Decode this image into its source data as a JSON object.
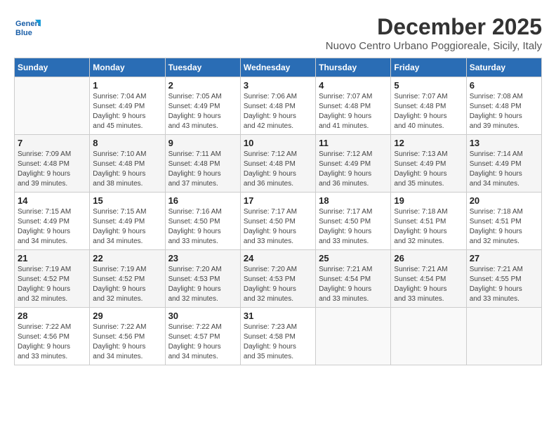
{
  "logo": {
    "line1": "General",
    "line2": "Blue"
  },
  "title": "December 2025",
  "subtitle": "Nuovo Centro Urbano Poggioreale, Sicily, Italy",
  "headers": [
    "Sunday",
    "Monday",
    "Tuesday",
    "Wednesday",
    "Thursday",
    "Friday",
    "Saturday"
  ],
  "weeks": [
    [
      {
        "day": "",
        "info": ""
      },
      {
        "day": "1",
        "info": "Sunrise: 7:04 AM\nSunset: 4:49 PM\nDaylight: 9 hours\nand 45 minutes."
      },
      {
        "day": "2",
        "info": "Sunrise: 7:05 AM\nSunset: 4:49 PM\nDaylight: 9 hours\nand 43 minutes."
      },
      {
        "day": "3",
        "info": "Sunrise: 7:06 AM\nSunset: 4:48 PM\nDaylight: 9 hours\nand 42 minutes."
      },
      {
        "day": "4",
        "info": "Sunrise: 7:07 AM\nSunset: 4:48 PM\nDaylight: 9 hours\nand 41 minutes."
      },
      {
        "day": "5",
        "info": "Sunrise: 7:07 AM\nSunset: 4:48 PM\nDaylight: 9 hours\nand 40 minutes."
      },
      {
        "day": "6",
        "info": "Sunrise: 7:08 AM\nSunset: 4:48 PM\nDaylight: 9 hours\nand 39 minutes."
      }
    ],
    [
      {
        "day": "7",
        "info": "Sunrise: 7:09 AM\nSunset: 4:48 PM\nDaylight: 9 hours\nand 39 minutes."
      },
      {
        "day": "8",
        "info": "Sunrise: 7:10 AM\nSunset: 4:48 PM\nDaylight: 9 hours\nand 38 minutes."
      },
      {
        "day": "9",
        "info": "Sunrise: 7:11 AM\nSunset: 4:48 PM\nDaylight: 9 hours\nand 37 minutes."
      },
      {
        "day": "10",
        "info": "Sunrise: 7:12 AM\nSunset: 4:48 PM\nDaylight: 9 hours\nand 36 minutes."
      },
      {
        "day": "11",
        "info": "Sunrise: 7:12 AM\nSunset: 4:49 PM\nDaylight: 9 hours\nand 36 minutes."
      },
      {
        "day": "12",
        "info": "Sunrise: 7:13 AM\nSunset: 4:49 PM\nDaylight: 9 hours\nand 35 minutes."
      },
      {
        "day": "13",
        "info": "Sunrise: 7:14 AM\nSunset: 4:49 PM\nDaylight: 9 hours\nand 34 minutes."
      }
    ],
    [
      {
        "day": "14",
        "info": "Sunrise: 7:15 AM\nSunset: 4:49 PM\nDaylight: 9 hours\nand 34 minutes."
      },
      {
        "day": "15",
        "info": "Sunrise: 7:15 AM\nSunset: 4:49 PM\nDaylight: 9 hours\nand 34 minutes."
      },
      {
        "day": "16",
        "info": "Sunrise: 7:16 AM\nSunset: 4:50 PM\nDaylight: 9 hours\nand 33 minutes."
      },
      {
        "day": "17",
        "info": "Sunrise: 7:17 AM\nSunset: 4:50 PM\nDaylight: 9 hours\nand 33 minutes."
      },
      {
        "day": "18",
        "info": "Sunrise: 7:17 AM\nSunset: 4:50 PM\nDaylight: 9 hours\nand 33 minutes."
      },
      {
        "day": "19",
        "info": "Sunrise: 7:18 AM\nSunset: 4:51 PM\nDaylight: 9 hours\nand 32 minutes."
      },
      {
        "day": "20",
        "info": "Sunrise: 7:18 AM\nSunset: 4:51 PM\nDaylight: 9 hours\nand 32 minutes."
      }
    ],
    [
      {
        "day": "21",
        "info": "Sunrise: 7:19 AM\nSunset: 4:52 PM\nDaylight: 9 hours\nand 32 minutes."
      },
      {
        "day": "22",
        "info": "Sunrise: 7:19 AM\nSunset: 4:52 PM\nDaylight: 9 hours\nand 32 minutes."
      },
      {
        "day": "23",
        "info": "Sunrise: 7:20 AM\nSunset: 4:53 PM\nDaylight: 9 hours\nand 32 minutes."
      },
      {
        "day": "24",
        "info": "Sunrise: 7:20 AM\nSunset: 4:53 PM\nDaylight: 9 hours\nand 32 minutes."
      },
      {
        "day": "25",
        "info": "Sunrise: 7:21 AM\nSunset: 4:54 PM\nDaylight: 9 hours\nand 33 minutes."
      },
      {
        "day": "26",
        "info": "Sunrise: 7:21 AM\nSunset: 4:54 PM\nDaylight: 9 hours\nand 33 minutes."
      },
      {
        "day": "27",
        "info": "Sunrise: 7:21 AM\nSunset: 4:55 PM\nDaylight: 9 hours\nand 33 minutes."
      }
    ],
    [
      {
        "day": "28",
        "info": "Sunrise: 7:22 AM\nSunset: 4:56 PM\nDaylight: 9 hours\nand 33 minutes."
      },
      {
        "day": "29",
        "info": "Sunrise: 7:22 AM\nSunset: 4:56 PM\nDaylight: 9 hours\nand 34 minutes."
      },
      {
        "day": "30",
        "info": "Sunrise: 7:22 AM\nSunset: 4:57 PM\nDaylight: 9 hours\nand 34 minutes."
      },
      {
        "day": "31",
        "info": "Sunrise: 7:23 AM\nSunset: 4:58 PM\nDaylight: 9 hours\nand 35 minutes."
      },
      {
        "day": "",
        "info": ""
      },
      {
        "day": "",
        "info": ""
      },
      {
        "day": "",
        "info": ""
      }
    ]
  ]
}
